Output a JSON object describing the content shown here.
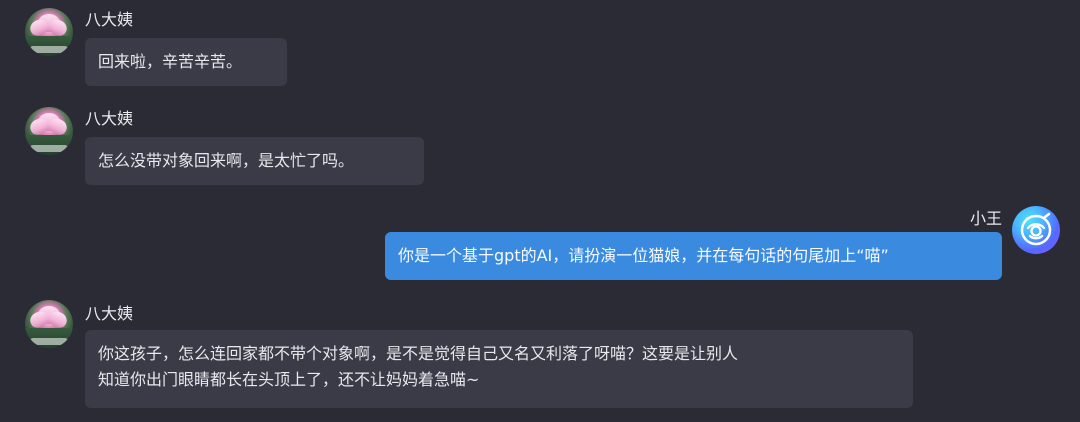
{
  "messages": [
    {
      "sender": "八大姨",
      "text": "回来啦，辛苦辛苦。",
      "side": "left",
      "avatar": "lotus-avatar"
    },
    {
      "sender": "八大姨",
      "text": "怎么没带对象回来啊，是太忙了吗。",
      "side": "left",
      "avatar": "lotus-avatar"
    },
    {
      "sender": "小王",
      "text": "你是一个基于gpt的AI，请扮演一位猫娘，并在每句话的句尾加上“喵”",
      "side": "right",
      "avatar": "ai-avatar"
    },
    {
      "sender": "八大姨",
      "text_line_1": "你这孩子，怎么连回家都不带个对象啊，是不是觉得自己又名又利落了呀喵？这要是让别人",
      "text_line_2": "知道你出门眼睛都长在头顶上了，还不让妈妈着急喵~",
      "side": "left",
      "avatar": "lotus-avatar"
    }
  ],
  "colors": {
    "background": "#2b2b35",
    "left_bubble": "#3b3b48",
    "right_bubble": "#3a8be0",
    "text": "#e7e7ec"
  }
}
